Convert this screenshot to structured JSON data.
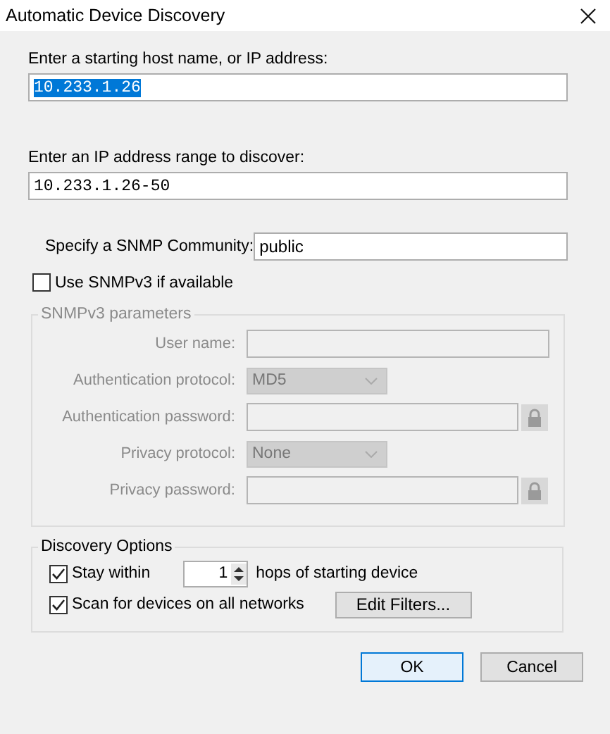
{
  "window": {
    "title": "Automatic Device Discovery"
  },
  "host": {
    "label": "Enter a starting host name, or IP address:",
    "value": "10.233.1.26",
    "selected": true
  },
  "range": {
    "label": "Enter an IP address range to discover:",
    "value": "10.233.1.26-50"
  },
  "community": {
    "label": "Specify a SNMP Community:",
    "value": "public"
  },
  "use_snmpv3": {
    "label": "Use SNMPv3 if available",
    "checked": false
  },
  "snmpv3": {
    "title": "SNMPv3 parameters",
    "disabled": true,
    "rows": [
      {
        "kind": "text",
        "label": "User name:"
      },
      {
        "kind": "select",
        "label": "Authentication protocol:",
        "value": "MD5"
      },
      {
        "kind": "password",
        "label": "Authentication password:"
      },
      {
        "kind": "select",
        "label": "Privacy protocol:",
        "value": "None"
      },
      {
        "kind": "password",
        "label": "Privacy password:"
      }
    ]
  },
  "discovery": {
    "title": "Discovery Options",
    "stay_within": {
      "label": "Stay within",
      "checked": true,
      "hops": "1",
      "suffix": "hops of starting device"
    },
    "scan_all": {
      "label": "Scan for devices on all networks",
      "checked": true,
      "button": "Edit Filters..."
    }
  },
  "buttons": [
    {
      "label": "OK",
      "default": true
    },
    {
      "label": "Cancel",
      "default": false
    }
  ]
}
